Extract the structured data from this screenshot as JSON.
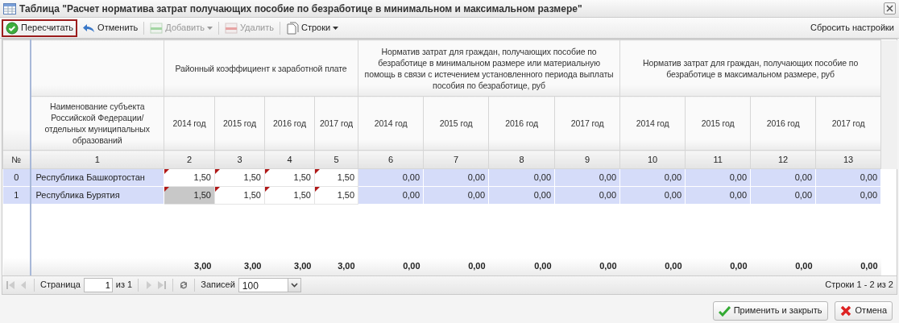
{
  "window": {
    "title": "Таблица \"Расчет норматива затрат получающих пособие по безработице в минимальном и максимальном размере\""
  },
  "toolbar": {
    "buttons": [
      {
        "label": "Пересчитать",
        "kind": "recalc",
        "disabled": false,
        "focused": true,
        "dropdown": false
      },
      {
        "label": "Отменить",
        "kind": "undo",
        "disabled": false,
        "focused": false,
        "dropdown": false
      },
      {
        "label": "Добавить",
        "kind": "add",
        "disabled": true,
        "focused": false,
        "dropdown": true
      },
      {
        "label": "Удалить",
        "kind": "delete",
        "disabled": true,
        "focused": false,
        "dropdown": false
      },
      {
        "label": "Строки",
        "kind": "rows",
        "disabled": false,
        "focused": false,
        "dropdown": true
      }
    ],
    "reset": "Сбросить настройки"
  },
  "table": {
    "number_label": "№",
    "name_label": "Наименование субъекта Российской Федерации/ отдельных муниципальных образований",
    "name_number": "1",
    "groups": [
      {
        "title": "Районный коэффициент к заработной плате",
        "kind": "input",
        "columns": [
          {
            "label": "2014 год",
            "number": "2"
          },
          {
            "label": "2015 год",
            "number": "3"
          },
          {
            "label": "2016 год",
            "number": "4"
          },
          {
            "label": "2017 год",
            "number": "5"
          }
        ]
      },
      {
        "title": "Норматив затрат для граждан, получающих пособие по безработице в минимальном размере или материальную помощь в связи с истечением установленного периода выплаты пособия по безработице, руб",
        "kind": "computed",
        "columns": [
          {
            "label": "2014 год",
            "number": "6"
          },
          {
            "label": "2015 год",
            "number": "7"
          },
          {
            "label": "2016 год",
            "number": "8"
          },
          {
            "label": "2017 год",
            "number": "9"
          }
        ]
      },
      {
        "title": "Норматив затрат для граждан, получающих пособие по безработице в максимальном размере, руб",
        "kind": "computed",
        "columns": [
          {
            "label": "2014 год",
            "number": "10"
          },
          {
            "label": "2015 год",
            "number": "11"
          },
          {
            "label": "2016 год",
            "number": "12"
          },
          {
            "label": "2017 год",
            "number": "13"
          }
        ]
      }
    ],
    "rows": [
      {
        "index": "0",
        "name": "Республика Башкортостан",
        "cells": [
          {
            "value": "1,50",
            "edited": true,
            "selected": false
          },
          {
            "value": "1,50",
            "edited": true,
            "selected": false
          },
          {
            "value": "1,50",
            "edited": true,
            "selected": false
          },
          {
            "value": "1,50",
            "edited": true,
            "selected": false
          },
          {
            "value": "0,00",
            "edited": false,
            "selected": false
          },
          {
            "value": "0,00",
            "edited": false,
            "selected": false
          },
          {
            "value": "0,00",
            "edited": false,
            "selected": false
          },
          {
            "value": "0,00",
            "edited": false,
            "selected": false
          },
          {
            "value": "0,00",
            "edited": false,
            "selected": false
          },
          {
            "value": "0,00",
            "edited": false,
            "selected": false
          },
          {
            "value": "0,00",
            "edited": false,
            "selected": false
          },
          {
            "value": "0,00",
            "edited": false,
            "selected": false
          }
        ]
      },
      {
        "index": "1",
        "name": "Республика Бурятия",
        "cells": [
          {
            "value": "1,50",
            "edited": true,
            "selected": true
          },
          {
            "value": "1,50",
            "edited": true,
            "selected": false
          },
          {
            "value": "1,50",
            "edited": true,
            "selected": false
          },
          {
            "value": "1,50",
            "edited": true,
            "selected": false
          },
          {
            "value": "0,00",
            "edited": false,
            "selected": false
          },
          {
            "value": "0,00",
            "edited": false,
            "selected": false
          },
          {
            "value": "0,00",
            "edited": false,
            "selected": false
          },
          {
            "value": "0,00",
            "edited": false,
            "selected": false
          },
          {
            "value": "0,00",
            "edited": false,
            "selected": false
          },
          {
            "value": "0,00",
            "edited": false,
            "selected": false
          },
          {
            "value": "0,00",
            "edited": false,
            "selected": false
          },
          {
            "value": "0,00",
            "edited": false,
            "selected": false
          }
        ]
      }
    ],
    "totals": [
      "3,00",
      "3,00",
      "3,00",
      "3,00",
      "0,00",
      "0,00",
      "0,00",
      "0,00",
      "0,00",
      "0,00",
      "0,00",
      "0,00"
    ]
  },
  "pager": {
    "page_label": "Страница",
    "page": "1",
    "of": "из 1",
    "records_label": "Записей",
    "records": "100",
    "summary": "Строки 1 - 2 из 2"
  },
  "footer": {
    "buttons": [
      {
        "label": "Применить и закрыть",
        "kind": "apply"
      },
      {
        "label": "Отмена",
        "kind": "cancel"
      }
    ]
  }
}
